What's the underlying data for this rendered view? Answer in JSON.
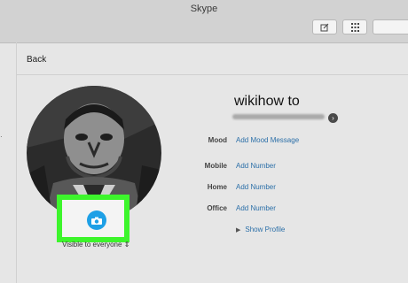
{
  "window": {
    "title": "Skype"
  },
  "toolbar": {
    "compose_icon": "compose-icon",
    "dialpad_icon": "dialpad-icon"
  },
  "nav": {
    "back_label": "Back"
  },
  "profile": {
    "display_name": "wikihow to",
    "visibility_label": "Visible to everyone",
    "fields": [
      {
        "label": "Mood",
        "value": "Add Mood Message"
      },
      {
        "label": "Mobile",
        "value": "Add Number"
      },
      {
        "label": "Home",
        "value": "Add Number"
      },
      {
        "label": "Office",
        "value": "Add Number"
      }
    ],
    "show_profile_label": "Show Profile"
  },
  "colors": {
    "accent": "#1ea0e6",
    "link": "#2b6fa8",
    "highlight": "#3df52c"
  }
}
